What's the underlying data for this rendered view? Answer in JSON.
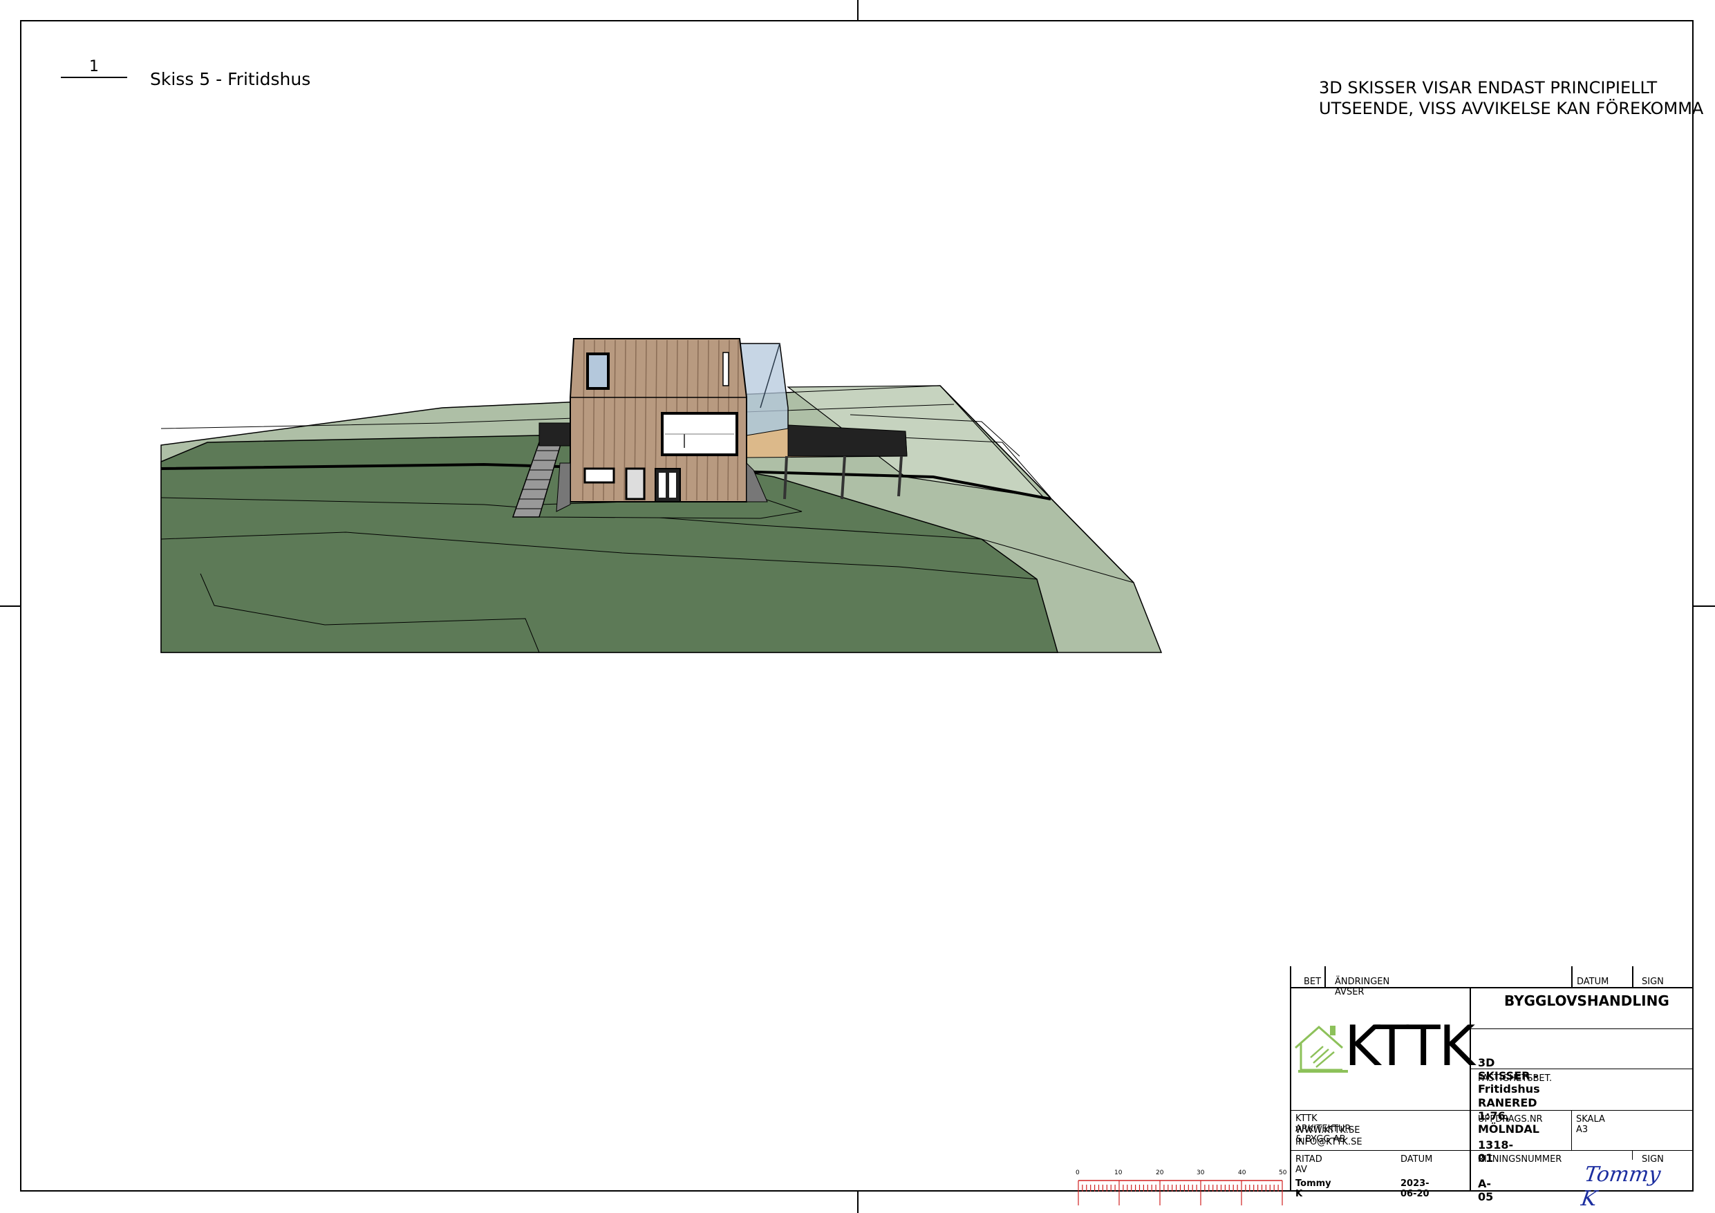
{
  "view": {
    "number": "1",
    "title": "Skiss 5 - Fritidshus"
  },
  "note": {
    "line1": "3D SKISSER VISAR ENDAST PRINCIPIELLT",
    "line2": "UTSEENDE, VISS AVVIKELSE KAN FÖREKOMMA"
  },
  "title_block": {
    "revision_headers": {
      "bet": "BET",
      "change": "ÄNDRINGEN AVSER",
      "date": "DATUM",
      "sign": "SIGN"
    },
    "stage": "BYGGLOVSHANDLING",
    "logo_text": "KTTK",
    "drawing_title": "3D SKISSER - Fritidshus",
    "property_label": "FASTIGHETSBET.",
    "property_value": "RANERED 1:76, MÖLNDAL",
    "company": {
      "name": "KTTK ARKITEKTUR & BYGG AB",
      "web": "WWW.KTTK.SE",
      "email": "INFO@KTTK.SE"
    },
    "assignment_label": "UPPDRAGS.NR",
    "assignment_value": "1318-01",
    "scale_label": "SKALA A3",
    "drawn_by_label": "RITAD AV",
    "drawn_by_value": "Tommy K",
    "date_label": "DATUM",
    "date_value": "2023-06-20",
    "drawing_no_label": "RITNINGSNUMMER",
    "drawing_no_value": "A-05",
    "sign_label": "SIGN",
    "signature": "Tommy K"
  },
  "scale_bar": {
    "labels": [
      "0",
      "10",
      "20",
      "30",
      "40",
      "50"
    ],
    "color": "#d02020"
  },
  "colors": {
    "grass_dark": "#5d7a57",
    "grass_light": "#aebfa6",
    "grass_mid": "#c6d3bf",
    "wood": "#b89a80",
    "glass": "#b4c8dc",
    "deck": "#222222"
  }
}
